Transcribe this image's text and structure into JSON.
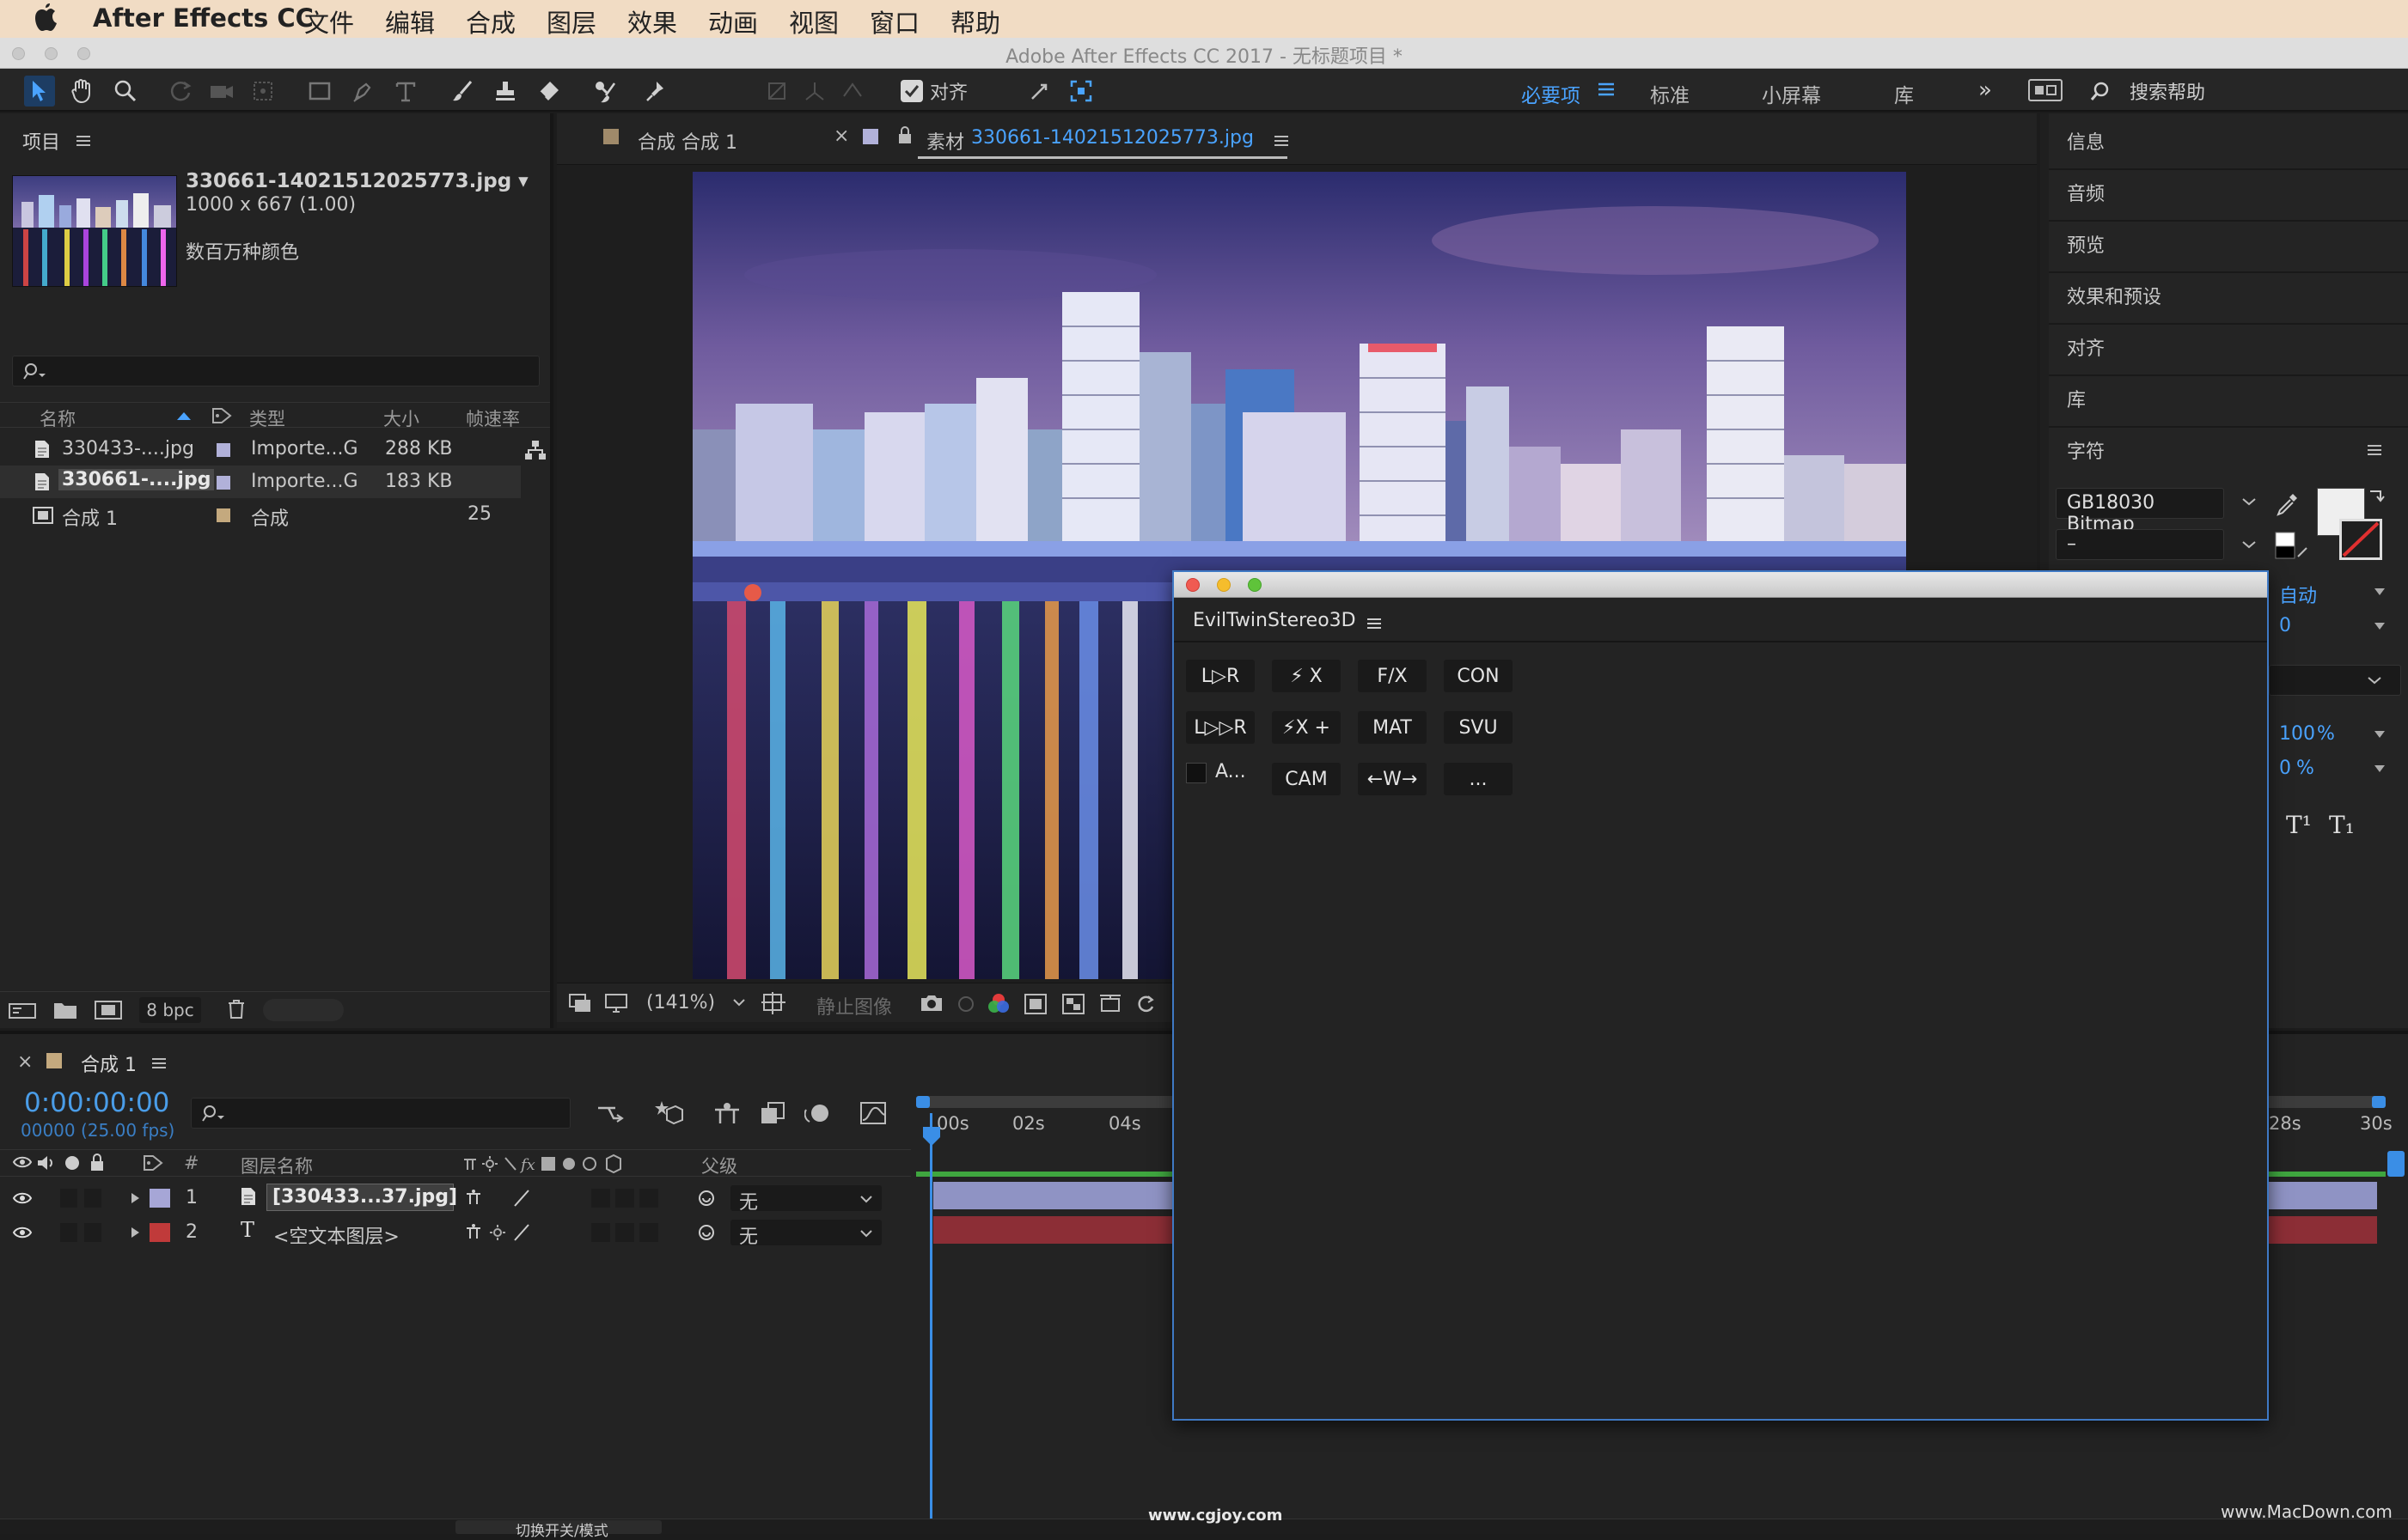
{
  "menubar": {
    "app_name": "After Effects CC",
    "items": [
      "文件",
      "编辑",
      "合成",
      "图层",
      "效果",
      "动画",
      "视图",
      "窗口",
      "帮助"
    ]
  },
  "window": {
    "title": "Adobe After Effects CC 2017 - 无标题项目 *"
  },
  "toolbar": {
    "align_label": "对齐",
    "workspaces": {
      "essentials": "必要项",
      "standard": "标准",
      "small_screen": "小屏幕",
      "libraries": "库"
    },
    "search_placeholder": "搜索帮助"
  },
  "project": {
    "title": "项目",
    "selected": {
      "name": "330661-14021512025773.jpg ▾",
      "dims": "1000 x 667 (1.00)",
      "color_info": "数百万种颜色"
    },
    "headers": {
      "name": "名称",
      "type": "类型",
      "size": "大小",
      "fps": "帧速率"
    },
    "rows": [
      {
        "name": "330433-....jpg",
        "type": "Importe...G",
        "size": "288 KB",
        "fps": "",
        "color": "#b1b1d9"
      },
      {
        "name": "330661-....jpg",
        "type": "Importe...G",
        "size": "183 KB",
        "fps": "",
        "color": "#b1b1d9"
      },
      {
        "name": "合成 1",
        "type": "合成",
        "size": "",
        "fps": "25",
        "color": "#c4a97e"
      }
    ],
    "bpc": "8 bpc"
  },
  "viewer": {
    "tab_comp": "合成 合成 1",
    "tab_footage_prefix": "素材",
    "tab_footage_name": "330661-14021512025773.jpg",
    "zoom": "(141%)",
    "still_label": "静止图像"
  },
  "right_panel": {
    "items": [
      "信息",
      "音频",
      "预览",
      "效果和预设",
      "对齐",
      "库"
    ],
    "character": {
      "title": "字符",
      "font": "GB18030 Bitmap",
      "style": "–",
      "leading": "自动",
      "tracking": "0",
      "scale": "100",
      "baseline": "0",
      "pct": "%",
      "super": "T¹",
      "sub": "T₁"
    }
  },
  "plugin": {
    "title": "EvilTwinStereo3D",
    "buttons_row1": [
      "L▷R",
      "⚡ X",
      "F/X",
      "CON"
    ],
    "buttons_row2": [
      "L▷▷R",
      "⚡X +",
      "MAT",
      "SVU"
    ],
    "row3_check_label": "A...",
    "buttons_row3": [
      "CAM",
      "←W→",
      "..."
    ]
  },
  "timeline": {
    "tab": "合成 1",
    "timecode": "0:00:00:00",
    "frames": "00000 (25.00 fps)",
    "ruler": [
      "00s",
      "02s",
      "04s",
      "28s",
      "30s"
    ],
    "headers": {
      "hash": "#",
      "layer_name": "图层名称",
      "parent": "父级"
    },
    "layers": [
      {
        "num": "1",
        "name": "[330433...37.jpg]",
        "parent": "无",
        "color": "#a6a6d6"
      },
      {
        "num": "2",
        "name": "<空文本图层>",
        "parent": "无",
        "color": "#c03a3a"
      }
    ],
    "bottom_label": "切换开关/模式"
  },
  "watermarks": {
    "left": "www.cgjoy.com",
    "right": "www.MacDown.com"
  },
  "colors": {
    "accent_blue": "#3a8ee6",
    "timecode_blue": "#4a9de8",
    "menu_bg": "#f1dcc4",
    "panel_bg": "#232323"
  }
}
